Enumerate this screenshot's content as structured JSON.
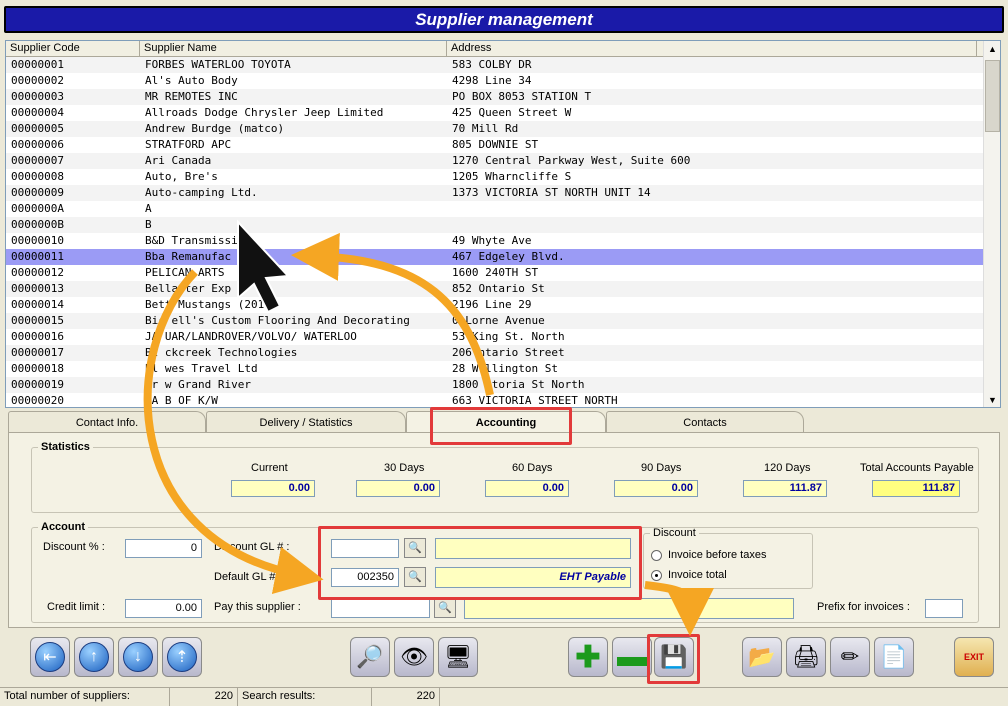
{
  "window": {
    "title": "Supplier management"
  },
  "grid": {
    "columns": [
      "Supplier Code",
      "Supplier Name",
      "Address"
    ],
    "rows": [
      [
        "00000001",
        "FORBES WATERLOO TOYOTA",
        "583 COLBY DR"
      ],
      [
        "00000002",
        "Al's Auto Body",
        "4298 Line 34"
      ],
      [
        "00000003",
        "MR REMOTES INC",
        "PO BOX 8053 STATION T"
      ],
      [
        "00000004",
        "Allroads Dodge Chrysler Jeep Limited",
        "425 Queen Street W"
      ],
      [
        "00000005",
        "Andrew Burdge (matco)",
        "70 Mill Rd"
      ],
      [
        "00000006",
        "STRATFORD APC",
        "805 DOWNIE ST"
      ],
      [
        "00000007",
        "Ari Canada",
        "1270 Central Parkway West, Suite 600"
      ],
      [
        "00000008",
        "Auto, Bre's",
        "1205 Wharncliffe S"
      ],
      [
        "00000009",
        "Auto-camping Ltd.",
        "1373 VICTORIA ST NORTH UNIT 14"
      ],
      [
        "0000000A",
        "A",
        ""
      ],
      [
        "0000000B",
        "B",
        ""
      ],
      [
        "00000010",
        "B&D Transmissio",
        "49 Whyte Ave"
      ],
      [
        "00000011",
        "Bba Remanufac    g",
        "467 Edgeley Blvd."
      ],
      [
        "00000012",
        "PELICAN ARTS",
        "1600 240TH ST"
      ],
      [
        "00000013",
        "Bella    ter Exp    s",
        "852 Ontario St"
      ],
      [
        "00000014",
        "Bett  Mustangs (2012)",
        "2196 Line 29"
      ],
      [
        "00000015",
        "Bic   ell's Custom Flooring And Decorating",
        "  0 Lorne Avenue"
      ],
      [
        "00000016",
        "JA   UAR/LANDROVER/VOLVO/ WATERLOO",
        "53  King St. North"
      ],
      [
        "00000017",
        "Bl  ckcreek Technologies",
        "206  ntario Street"
      ],
      [
        "00000018",
        "Bl  wes Travel Ltd",
        "28 W  llington St"
      ],
      [
        "00000019",
        "Br  w Grand River",
        "1800  ctoria St North"
      ],
      [
        "00000020",
        "SA  B OF K/W",
        "663 VICTORIA STREET NORTH"
      ]
    ],
    "selected_index": 12
  },
  "tabs": [
    {
      "label": "Contact Info."
    },
    {
      "label": "Delivery / Statistics"
    },
    {
      "label": "Accounting"
    },
    {
      "label": "Contacts"
    }
  ],
  "statistics": {
    "legend": "Statistics",
    "columns": [
      {
        "label": "Current",
        "value": "0.00"
      },
      {
        "label": "30 Days",
        "value": "0.00"
      },
      {
        "label": "60 Days",
        "value": "0.00"
      },
      {
        "label": "90 Days",
        "value": "0.00"
      },
      {
        "label": "120 Days",
        "value": "111.87"
      },
      {
        "label": "Total Accounts Payable",
        "value": "111.87"
      }
    ]
  },
  "account": {
    "legend": "Account",
    "discount_label": "Discount % :",
    "discount_value": "0",
    "discount_gl_label": "Discount GL # :",
    "default_gl_label": "Default GL # :",
    "default_gl_value": "002350",
    "default_gl_desc": "EHT Payable",
    "credit_limit_label": "Credit limit :",
    "credit_limit_value": "0.00",
    "pay_supplier_label": "Pay this supplier :",
    "prefix_label": "Prefix for invoices :",
    "discount_group": {
      "legend": "Discount",
      "option1": "Invoice before taxes",
      "option2": "Invoice total"
    }
  },
  "toolbar": {
    "exit_label": "EXIT"
  },
  "status": {
    "total_label": "Total number of suppliers:",
    "total_value": "220",
    "search_label": "Search results:",
    "search_value": "220"
  },
  "colors": {
    "title_bg": "#1a1aa8",
    "selection": "#9b9bf5",
    "highlight": "#e23a3a",
    "arrow": "#f5a623"
  }
}
